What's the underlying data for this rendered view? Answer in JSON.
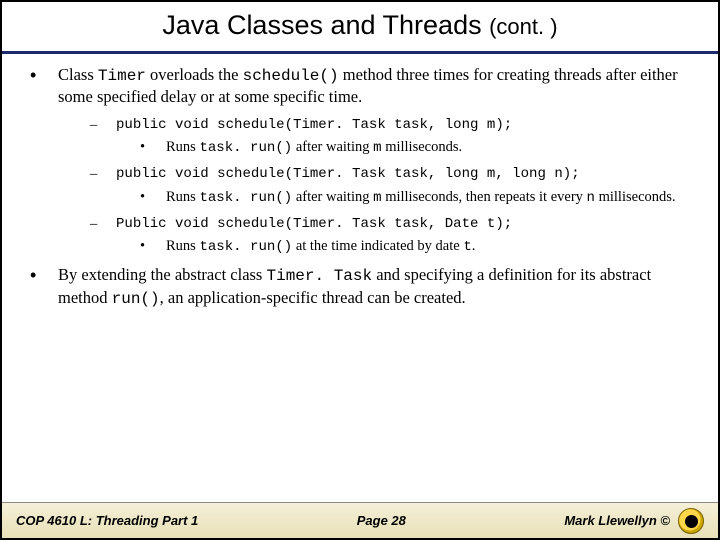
{
  "title_main": "Java Classes and Threads",
  "title_cont": "(cont. )",
  "p1": {
    "pre": "Class ",
    "c1": "Timer",
    "mid1": " overloads the ",
    "c2": "schedule()",
    "post": " method three times for creating threads after either some specified delay or at some specific time."
  },
  "sig1": "public void schedule(Timer. Task task, long m);",
  "d1": {
    "a": "Runs ",
    "c1": "task. run()",
    "b": " after waiting ",
    "c2": "m",
    "c": " milliseconds."
  },
  "sig2": "public void schedule(Timer. Task task, long m, long n);",
  "d2": {
    "a": "Runs ",
    "c1": "task. run()",
    "b": " after waiting ",
    "c2": "m",
    "c": " milliseconds, then repeats it every ",
    "c3": "n",
    "d": " milliseconds."
  },
  "sig3": "Public void schedule(Timer. Task task, Date t);",
  "d3": {
    "a": "Runs ",
    "c1": "task. run()",
    "b": " at the time indicated by date ",
    "c2": "t",
    "c": "."
  },
  "p2": {
    "a": "By extending the abstract class ",
    "c1": "Timer. Task",
    "b": " and specifying a definition for its abstract method ",
    "c2": "run()",
    "c": ", an application-specific thread can be created."
  },
  "footer": {
    "left": "COP 4610 L: Threading Part 1",
    "mid": "Page 28",
    "right": "Mark Llewellyn ©"
  }
}
